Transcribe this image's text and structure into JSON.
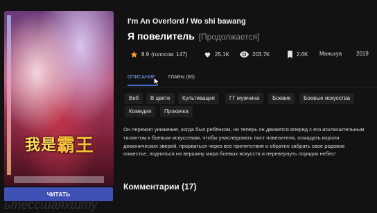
{
  "cover": {
    "logo_text": "我是霸王"
  },
  "read_button": {
    "label": "ЧИТАТЬ"
  },
  "title": {
    "en": "I'm An Overlord / Wo shi bawang",
    "ru": "Я повелитель",
    "status": "[Продолжается]"
  },
  "stats": {
    "rating": "8.9",
    "votes": "(голосов: 147)",
    "likes": "25.1K",
    "views": "203.7K",
    "bookmarks": "2.6K",
    "type": "Маньхуа",
    "year": "2019"
  },
  "tabs": [
    {
      "label": "ОПИСАНИЕ"
    },
    {
      "label": "ГЛАВЫ (66)"
    }
  ],
  "genres": [
    "Веб",
    "В цвете",
    "Культивация",
    "ГГ мужчина",
    "Боевик",
    "Боевые искусства",
    "Комедия",
    "Прокачка"
  ],
  "description": "Он пережил унижение, когда был ребёнком, но теперь он движется вперед с его исключительным талантом к боевым искусствам, чтобы унаследовать пост повелителя, осмадать короля демонических зверей, прорваться через все препятствия и обратно забрать свое родовое поместье, подняться на вершину мира боевых искусств и перевернуть порядок небес!",
  "comments": {
    "title": "Комментарии (17)"
  },
  "colors": {
    "accent": "#3f51b5",
    "tab_active": "#7aa8ff",
    "star": "#f5a623",
    "background": "#121212"
  }
}
